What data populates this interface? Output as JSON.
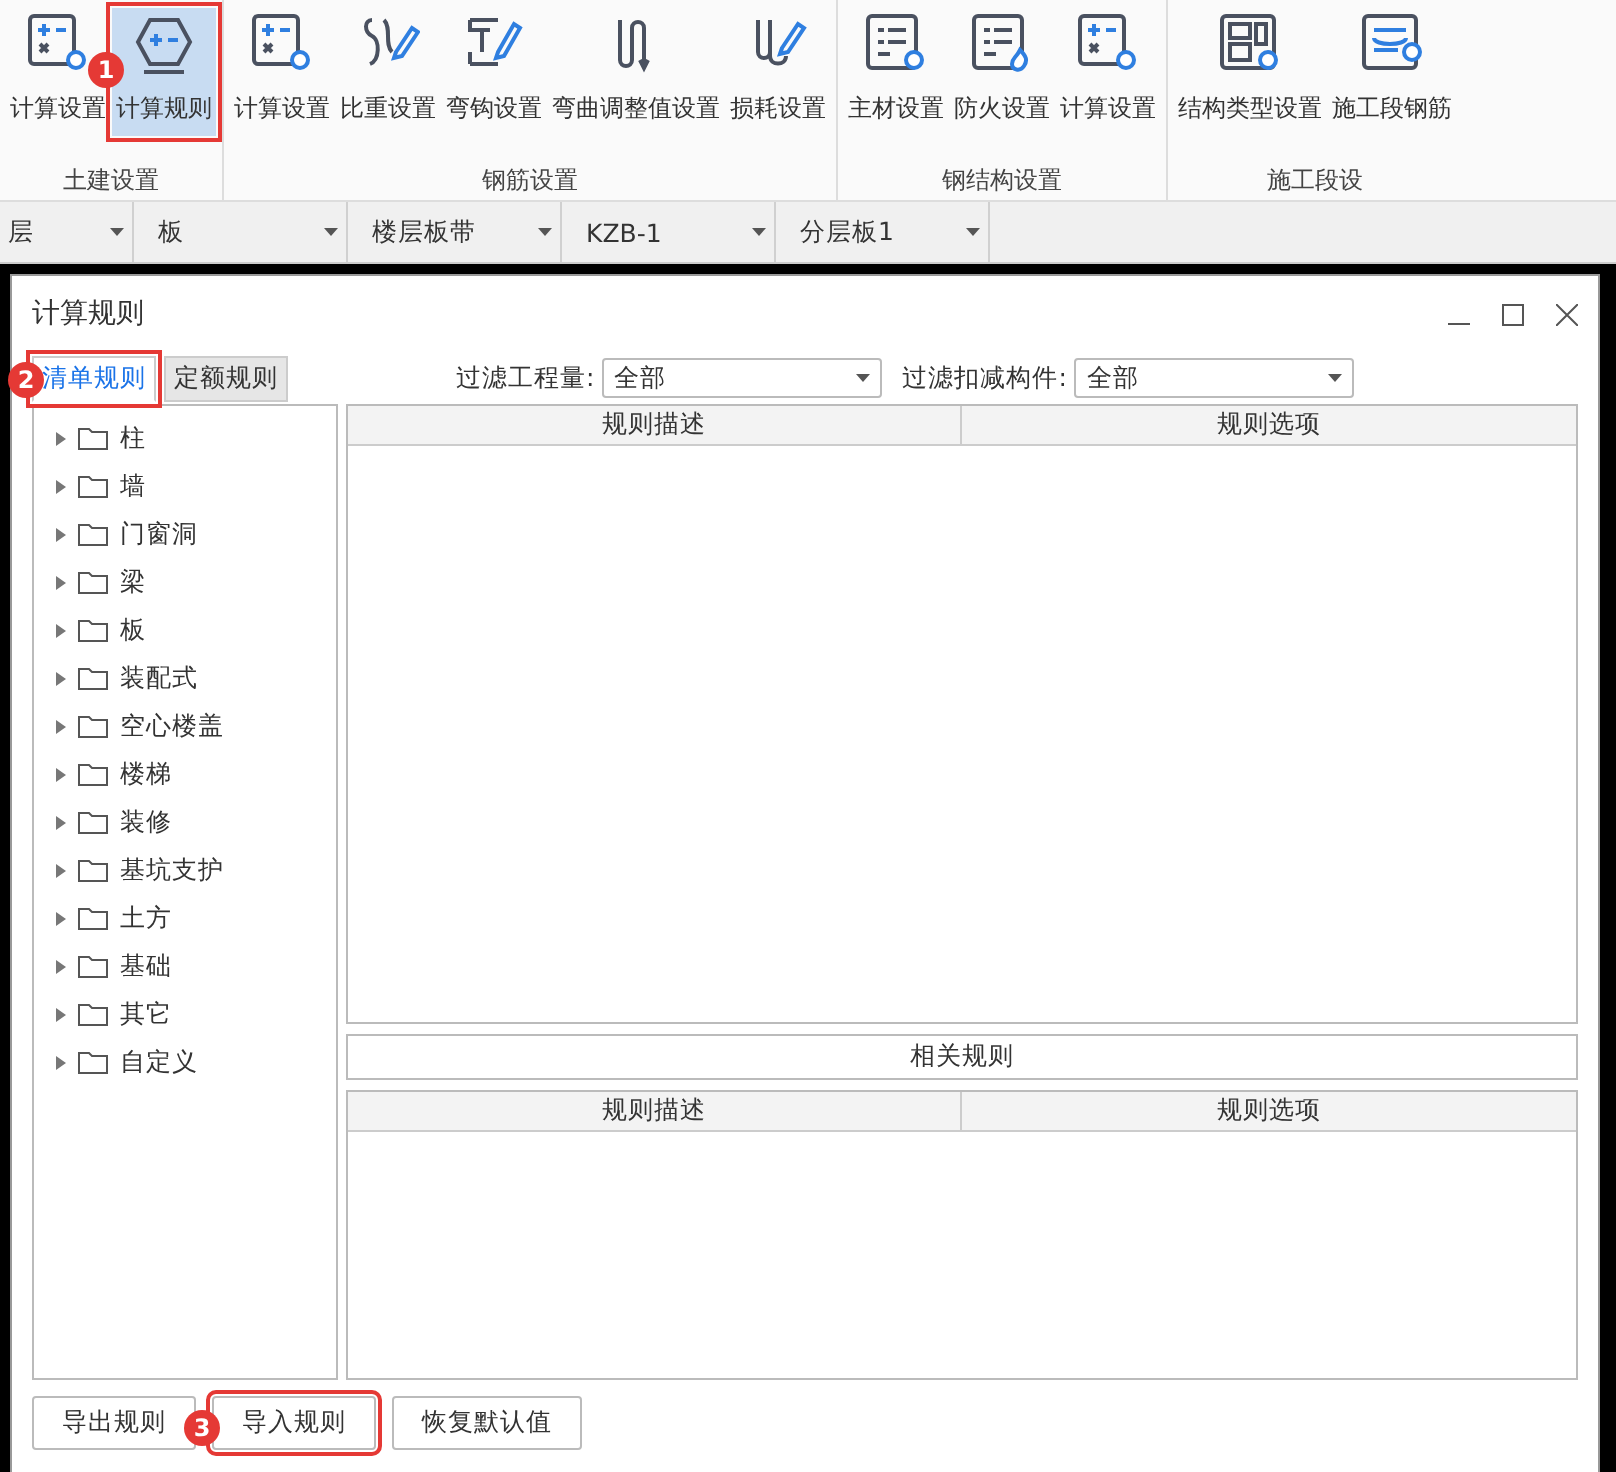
{
  "ribbon": {
    "groups": [
      {
        "label": "土建设置",
        "items": [
          {
            "label": "计算设置",
            "selected": false
          },
          {
            "label": "计算规则",
            "selected": true,
            "callout": "1"
          }
        ]
      },
      {
        "label": "钢筋设置",
        "items": [
          {
            "label": "计算设置",
            "selected": false
          },
          {
            "label": "比重设置",
            "selected": false
          },
          {
            "label": "弯钩设置",
            "selected": false
          },
          {
            "label": "弯曲调整值设置",
            "selected": false
          },
          {
            "label": "损耗设置",
            "selected": false
          }
        ]
      },
      {
        "label": "钢结构设置",
        "items": [
          {
            "label": "主材设置",
            "selected": false
          },
          {
            "label": "防火设置",
            "selected": false
          },
          {
            "label": "计算设置",
            "selected": false
          }
        ]
      },
      {
        "label": "施工段设",
        "items": [
          {
            "label": "结构类型设置",
            "selected": false
          },
          {
            "label": "施工段钢筋",
            "selected": false
          }
        ]
      }
    ]
  },
  "toolbar": {
    "dropdowns": [
      "层",
      "板",
      "楼层板带",
      "KZB-1",
      "分层板1"
    ]
  },
  "dialog": {
    "title": "计算规则",
    "tabs": [
      {
        "label": "清单规则",
        "selected": true,
        "callout": "2"
      },
      {
        "label": "定额规则",
        "selected": false
      }
    ],
    "filters": [
      {
        "label": "过滤工程量:",
        "value": "全部"
      },
      {
        "label": "过滤扣减构件:",
        "value": "全部"
      }
    ],
    "tree": [
      {
        "label": "柱",
        "expanded": false
      },
      {
        "label": "墙",
        "expanded": false
      },
      {
        "label": "门窗洞",
        "expanded": false
      },
      {
        "label": "梁",
        "expanded": false
      },
      {
        "label": "板",
        "expanded": false
      },
      {
        "label": "装配式",
        "expanded": false
      },
      {
        "label": "空心楼盖",
        "expanded": false
      },
      {
        "label": "楼梯",
        "expanded": false
      },
      {
        "label": "装修",
        "expanded": false
      },
      {
        "label": "基坑支护",
        "expanded": false
      },
      {
        "label": "土方",
        "expanded": false
      },
      {
        "label": "基础",
        "expanded": false
      },
      {
        "label": "其它",
        "expanded": false
      },
      {
        "label": "自定义",
        "expanded": false
      }
    ],
    "rules_table": {
      "columns": [
        "规则描述",
        "规则选项"
      ]
    },
    "related_title": "相关规则",
    "related_table": {
      "columns": [
        "规则描述",
        "规则选项"
      ]
    },
    "buttons": [
      {
        "label": "导出规则"
      },
      {
        "label": "导入规则",
        "callout": "3"
      },
      {
        "label": "恢复默认值"
      }
    ]
  }
}
